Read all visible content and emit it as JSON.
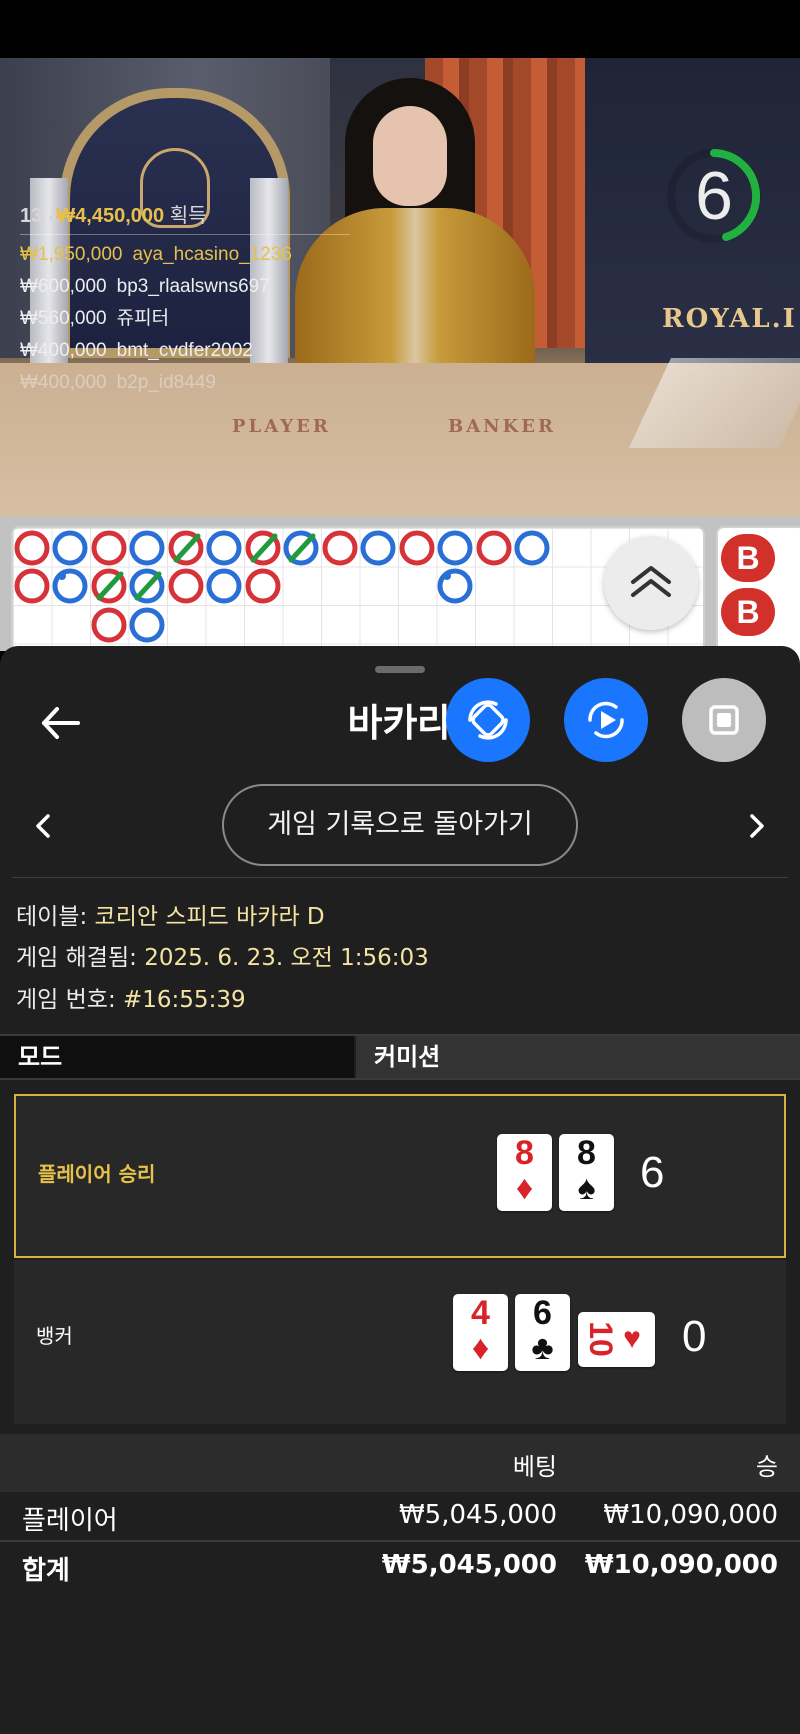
{
  "video": {
    "countdown": "6",
    "winners_count": "13",
    "winners_total": "₩4,450,000",
    "winners_label": "획득",
    "winners": [
      {
        "amount": "₩1,950,000",
        "user": "aya_hcasino_1236"
      },
      {
        "amount": "₩600,000",
        "user": "bp3_rlaalswns697"
      },
      {
        "amount": "₩560,000",
        "user": "쥬피터"
      },
      {
        "amount": "₩400,000",
        "user": "bmt_cvdfer2002"
      },
      {
        "amount": "₩400,000",
        "user": "b2p_id8449"
      }
    ],
    "felt_player": "PLAYER",
    "felt_banker": "BANKER",
    "brand": "ROYAL.I"
  },
  "roadmap": {
    "side_badges": [
      "B",
      "B"
    ]
  },
  "sheet": {
    "title": "바카라",
    "back_icon": "arrow-left-icon",
    "history_button": "게임 기록으로 돌아가기",
    "table_label": "테이블:",
    "table_value": "코리안 스피드 바카라 D",
    "resolved_label": "게임 해결됨:",
    "resolved_value": "2025. 6. 23. 오전 1:56:03",
    "game_no_label": "게임 번호:",
    "game_no_value": "#16:55:39",
    "tab_mode": "모드",
    "tab_commission": "커미션",
    "player_hand": {
      "label": "플레이어 승리",
      "score": "6",
      "cards": [
        {
          "rank": "8",
          "suit": "♦",
          "color": "red"
        },
        {
          "rank": "8",
          "suit": "♠",
          "color": "black"
        }
      ]
    },
    "banker_hand": {
      "label": "뱅커",
      "score": "0",
      "cards": [
        {
          "rank": "4",
          "suit": "♦",
          "color": "red"
        },
        {
          "rank": "6",
          "suit": "♣",
          "color": "black"
        },
        {
          "rank": "10",
          "suit": "♥",
          "color": "red",
          "sideways": true
        }
      ]
    },
    "bets": {
      "header_bet": "베팅",
      "header_win": "승",
      "rows": [
        {
          "name": "플레이어",
          "bet": "₩5,045,000",
          "win": "₩10,090,000"
        },
        {
          "name": "합계",
          "bet": "₩5,045,000",
          "win": "₩10,090,000"
        }
      ]
    },
    "colors": {
      "accent_blue": "#1a75ff",
      "win_gold": "#d6b43a",
      "value_cream": "#f3e4a3"
    }
  }
}
